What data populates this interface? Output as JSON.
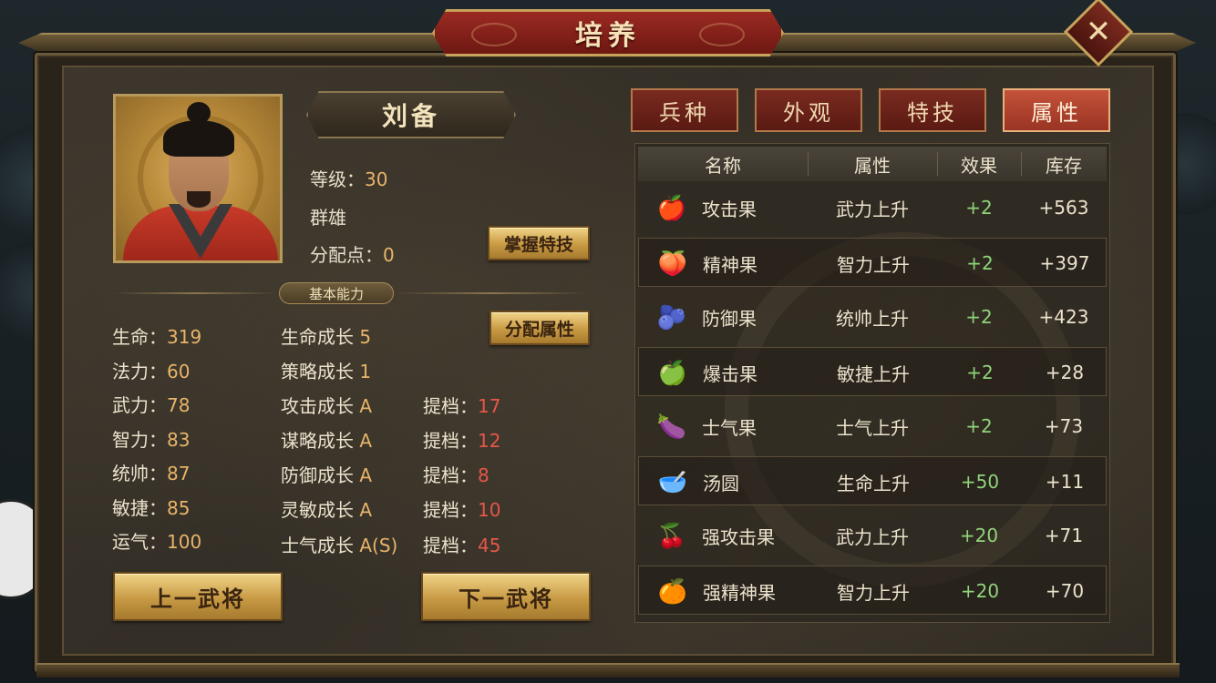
{
  "window": {
    "title": "培养",
    "close_icon": "close-icon"
  },
  "hero": {
    "name": "刘备",
    "level_label": "等级：",
    "level_value": "30",
    "faction": "群雄",
    "points_label": "分配点：",
    "points_value": "0"
  },
  "buttons": {
    "master_skill": "掌握特技",
    "allocate": "分配属性",
    "prev": "上一武将",
    "next": "下一武将"
  },
  "section_label": "基本能力",
  "stats": [
    {
      "label": "生命：",
      "value": "319"
    },
    {
      "label": "法力：",
      "value": "60"
    },
    {
      "label": "武力：",
      "value": "78"
    },
    {
      "label": "智力：",
      "value": "83"
    },
    {
      "label": "统帅：",
      "value": "87"
    },
    {
      "label": "敏捷：",
      "value": "85"
    },
    {
      "label": "运气：",
      "value": "100"
    }
  ],
  "growth": [
    {
      "label": "生命成长 ",
      "value": "5"
    },
    {
      "label": "策略成长 ",
      "value": "1"
    },
    {
      "label": "攻击成长 ",
      "value": "A",
      "tier_label": "提档：",
      "tier": "17"
    },
    {
      "label": "谋略成长 ",
      "value": "A",
      "tier_label": "提档：",
      "tier": "12"
    },
    {
      "label": "防御成长 ",
      "value": "A",
      "tier_label": "提档：",
      "tier": "8"
    },
    {
      "label": "灵敏成长 ",
      "value": "A",
      "tier_label": "提档：",
      "tier": "10"
    },
    {
      "label": "士气成长 ",
      "value": "A(S)",
      "tier_label": "提档：",
      "tier": "45"
    }
  ],
  "tabs": [
    {
      "label": "兵种",
      "active": false
    },
    {
      "label": "外观",
      "active": false
    },
    {
      "label": "特技",
      "active": false
    },
    {
      "label": "属性",
      "active": true
    }
  ],
  "table": {
    "headers": [
      "名称",
      "属性",
      "效果",
      "库存"
    ],
    "rows": [
      {
        "icon": "red-fruit-icon",
        "name": "攻击果",
        "attr": "武力上升",
        "effect": "+2",
        "stock": "+563"
      },
      {
        "icon": "pomegranate-icon",
        "name": "精神果",
        "attr": "智力上升",
        "effect": "+2",
        "stock": "+397"
      },
      {
        "icon": "blue-fruit-icon",
        "name": "防御果",
        "attr": "统帅上升",
        "effect": "+2",
        "stock": "+423"
      },
      {
        "icon": "green-fruit-icon",
        "name": "爆击果",
        "attr": "敏捷上升",
        "effect": "+2",
        "stock": "+28"
      },
      {
        "icon": "eggplant-icon",
        "name": "士气果",
        "attr": "士气上升",
        "effect": "+2",
        "stock": "+73"
      },
      {
        "icon": "soup-bowl-icon",
        "name": "汤圆",
        "attr": "生命上升",
        "effect": "+50",
        "stock": "+11"
      },
      {
        "icon": "cherry-cluster-icon",
        "name": "强攻击果",
        "attr": "武力上升",
        "effect": "+20",
        "stock": "+71"
      },
      {
        "icon": "orange-cluster-icon",
        "name": "强精神果",
        "attr": "智力上升",
        "effect": "+20",
        "stock": "+70"
      }
    ]
  },
  "colors": {
    "accent_red": "#9a2a22",
    "gold": "#c89a44",
    "value_gold": "#e8b46a",
    "effect_green": "#8fd47a",
    "tier_red": "#e8564a"
  }
}
